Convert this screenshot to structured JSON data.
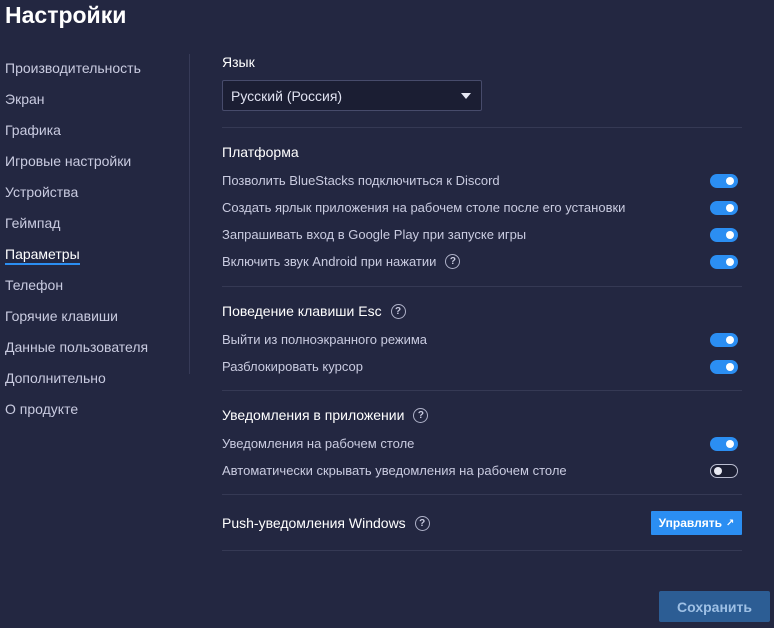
{
  "page_title": "Настройки",
  "sidebar": {
    "items": [
      {
        "label": "Производительность"
      },
      {
        "label": "Экран"
      },
      {
        "label": "Графика"
      },
      {
        "label": "Игровые настройки"
      },
      {
        "label": "Устройства"
      },
      {
        "label": "Геймпад"
      },
      {
        "label": "Параметры",
        "active": true
      },
      {
        "label": "Телефон"
      },
      {
        "label": "Горячие клавиши"
      },
      {
        "label": "Данные пользователя"
      },
      {
        "label": "Дополнительно"
      },
      {
        "label": "О продукте"
      }
    ]
  },
  "language": {
    "label": "Язык",
    "selected": "Русский (Россия)"
  },
  "platform": {
    "title": "Платформа",
    "rows": [
      {
        "label": "Позволить BlueStacks подключиться к Discord",
        "enabled": true
      },
      {
        "label": "Создать ярлык приложения на рабочем столе после его установки",
        "enabled": true
      },
      {
        "label": "Запрашивать вход в Google Play при запуске игры",
        "enabled": true
      },
      {
        "label": "Включить звук Android при нажатии",
        "enabled": true,
        "help": true
      }
    ]
  },
  "esc_behavior": {
    "title": "Поведение клавиши Esc",
    "rows": [
      {
        "label": "Выйти из полноэкранного режима",
        "enabled": true
      },
      {
        "label": "Разблокировать курсор",
        "enabled": true
      }
    ]
  },
  "notifications": {
    "title": "Уведомления в приложении",
    "rows": [
      {
        "label": "Уведомления на рабочем столе",
        "enabled": true
      },
      {
        "label": "Автоматически скрывать уведомления на рабочем столе",
        "enabled": false
      }
    ]
  },
  "push": {
    "title": "Push-уведомления Windows",
    "manage_label": "Управлять",
    "manage_icon": "external-link-icon"
  },
  "save_label": "Сохранить",
  "help_glyph": "?",
  "colors": {
    "background": "#232741",
    "accent": "#2b8ef2",
    "save_button": "#2c5d94"
  }
}
